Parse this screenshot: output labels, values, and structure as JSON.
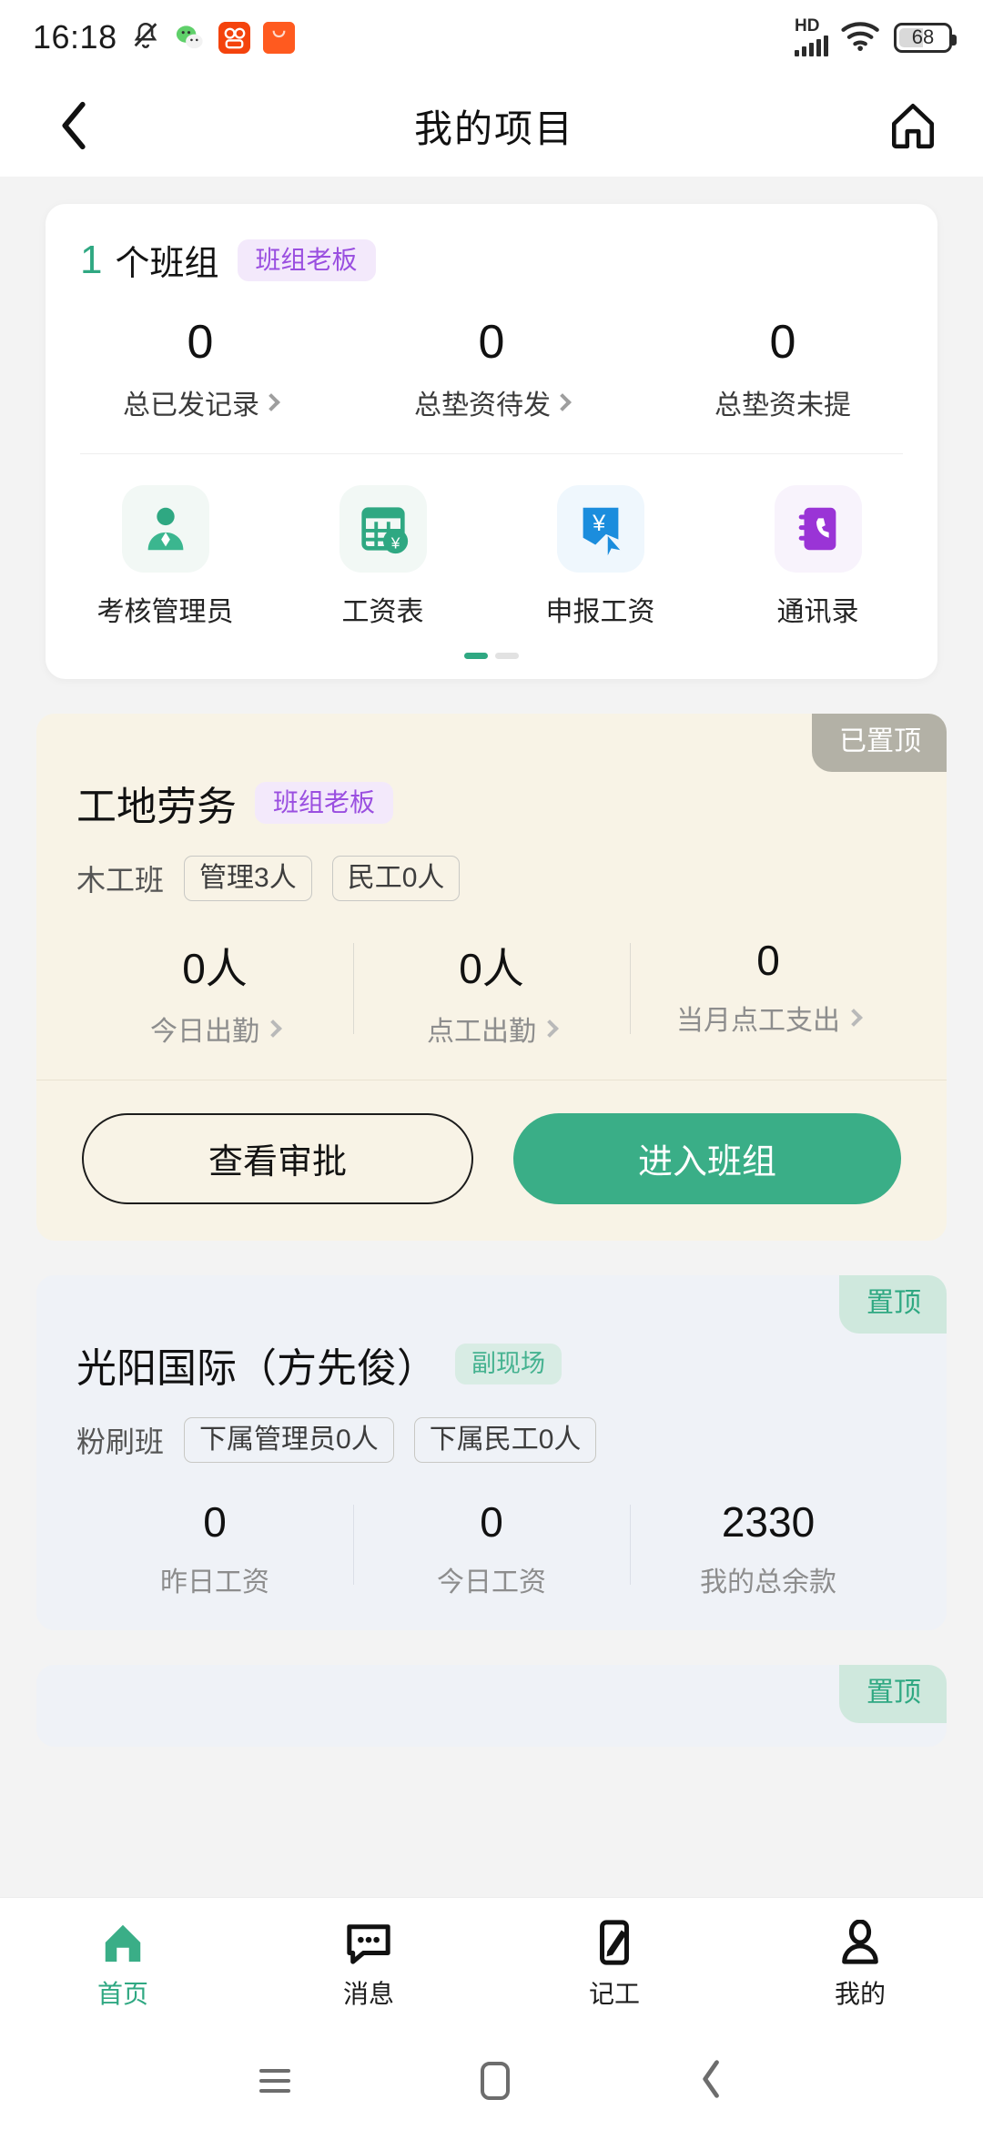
{
  "status_bar": {
    "time": "16:18",
    "icons": [
      "silent-bell-icon",
      "wechat-icon",
      "kuaishou-icon",
      "taobao-icon"
    ],
    "network_label": "HD",
    "battery_percent": "68"
  },
  "header": {
    "back_icon": "chevron-left-icon",
    "title": "我的项目",
    "home_icon": "home-icon"
  },
  "summary_card": {
    "count": "1",
    "count_suffix": "个班组",
    "role_badge": "班组老板",
    "stats": [
      {
        "value": "0",
        "label": "总已发记录",
        "has_chevron": true
      },
      {
        "value": "0",
        "label": "总垫资待发",
        "has_chevron": true
      },
      {
        "value": "0",
        "label": "总垫资未提",
        "has_chevron": false
      }
    ],
    "quick_actions": [
      {
        "label": "考核管理员",
        "icon": "manager-person-icon"
      },
      {
        "label": "工资表",
        "icon": "payroll-table-icon"
      },
      {
        "label": "申报工资",
        "icon": "declare-salary-icon"
      },
      {
        "label": "通讯录",
        "icon": "contacts-book-icon"
      }
    ],
    "pager": {
      "total": 2,
      "active": 0
    }
  },
  "projects": [
    {
      "pin_label": "已置顶",
      "pin_state": "pinned",
      "title": "工地劳务",
      "role_badge": "班组老板",
      "team_name": "木工班",
      "tags": [
        "管理3人",
        "民工0人"
      ],
      "stats": [
        {
          "value": "0人",
          "label": "今日出勤",
          "has_chevron": true
        },
        {
          "value": "0人",
          "label": "点工出勤",
          "has_chevron": true
        },
        {
          "value": "0",
          "label": "当月点工支出",
          "has_chevron": true
        }
      ],
      "actions": [
        {
          "label": "查看审批",
          "style": "outline"
        },
        {
          "label": "进入班组",
          "style": "fill"
        }
      ]
    },
    {
      "pin_label": "置顶",
      "pin_state": "unpinned",
      "title": "光阳国际（方先俊）",
      "role_badge": "副现场",
      "team_name": "粉刷班",
      "tags": [
        "下属管理员0人",
        "下属民工0人"
      ],
      "stats": [
        {
          "value": "0",
          "label": "昨日工资",
          "has_chevron": false
        },
        {
          "value": "0",
          "label": "今日工资",
          "has_chevron": false
        },
        {
          "value": "2330",
          "label": "我的总余款",
          "has_chevron": false
        }
      ]
    },
    {
      "pin_label": "置顶",
      "pin_state": "unpinned"
    }
  ],
  "tabbar": [
    {
      "label": "首页",
      "icon": "home-icon",
      "active": true
    },
    {
      "label": "消息",
      "icon": "message-bubble-icon",
      "active": false
    },
    {
      "label": "记工",
      "icon": "record-work-icon",
      "active": false
    },
    {
      "label": "我的",
      "icon": "person-icon",
      "active": false
    }
  ],
  "system_nav": [
    {
      "icon": "recents-icon"
    },
    {
      "icon": "home-square-icon"
    },
    {
      "icon": "back-chevron-icon"
    }
  ],
  "colors": {
    "accent_green": "#3aae87",
    "badge_purple": "#9a4fe0",
    "cream_card": "#f8f3e6",
    "blue_card": "#eff2f7"
  }
}
